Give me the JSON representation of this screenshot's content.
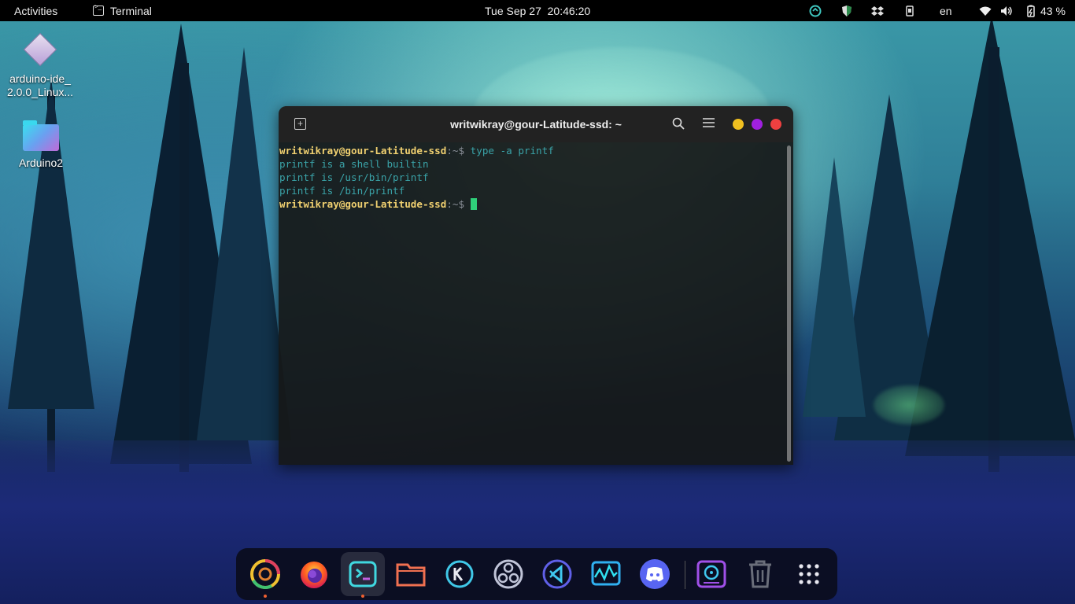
{
  "topbar": {
    "activities": "Activities",
    "app_name": "Terminal",
    "datetime": "Tue Sep 27  20:46:20",
    "lang": "en",
    "battery": "43 %"
  },
  "desktop": {
    "items": [
      {
        "label": "arduino-ide_\n2.0.0_Linux..."
      },
      {
        "label": "Arduino2"
      }
    ]
  },
  "terminal": {
    "title": "writwikray@gour-Latitude-ssd: ~",
    "lines": [
      {
        "user": "writwikray@gour-Latitude-ssd",
        "path": ":~$ ",
        "cmd": "type -a printf"
      },
      {
        "output": "printf is a shell builtin"
      },
      {
        "output": "printf is /usr/bin/printf"
      },
      {
        "output": "printf is /bin/printf"
      },
      {
        "user": "writwikray@gour-Latitude-ssd",
        "path": ":~$",
        "cmd": ""
      }
    ]
  },
  "dock": {
    "apps": [
      "chrome-icon",
      "firefox-icon",
      "terminal-icon",
      "files-icon",
      "kde-connect-icon",
      "obs-icon",
      "vscode-icon",
      "system-monitor-icon",
      "discord-icon",
      "disk-burner-icon",
      "trash-icon",
      "app-grid-icon"
    ]
  },
  "colors": {
    "user_prompt": "#f0d070",
    "output": "#3aa3a8",
    "cursor": "#2fd07a",
    "close": "#f04040",
    "maximize": "#a020e0",
    "minimize": "#f0c020"
  }
}
